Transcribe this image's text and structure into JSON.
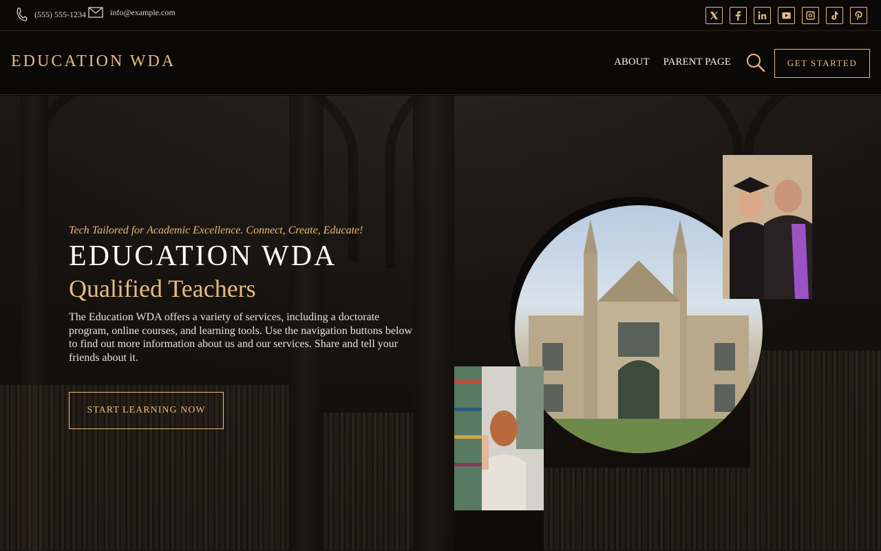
{
  "topbar": {
    "phone": "(555) 555-1234",
    "email": "info@example.com",
    "socials": [
      "x-icon",
      "facebook-icon",
      "linkedin-icon",
      "youtube-icon",
      "instagram-icon",
      "tiktok-icon",
      "pinterest-icon"
    ]
  },
  "header": {
    "logo": "EDUCATION WDA",
    "nav": [
      "ABOUT",
      "PARENT PAGE"
    ],
    "cta": "GET STARTED"
  },
  "hero": {
    "tagline": "Tech Tailored for Academic Excellence. Connect, Create, Educate!",
    "title": "EDUCATION WDA",
    "subtitle": "Qualified Teachers",
    "description": "The Education WDA offers a variety of services, including a doctorate program, online courses, and learning tools. Use the navigation buttons below to find out more information about us and our services. Share and tell your friends about it.",
    "button": "START LEARNING NOW"
  },
  "colors": {
    "accent": "#e9bb7e",
    "background": "#0b0908",
    "text": "#ffffff"
  }
}
